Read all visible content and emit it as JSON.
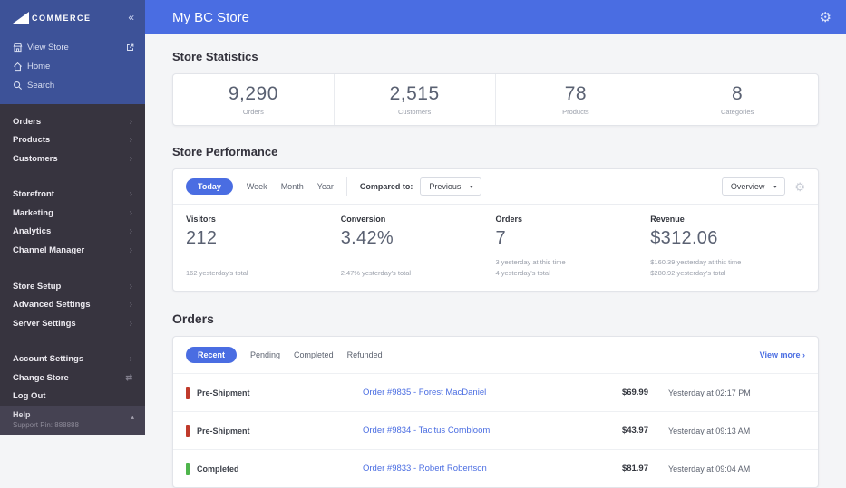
{
  "colors": {
    "header_blue": "#4a6de2",
    "sidebar_top_blue": "#3d5298",
    "sidebar_dark": "#37343f",
    "link_blue": "#4a6de2",
    "status_pre_shipment": "#c03a2b",
    "status_completed": "#4fb54c"
  },
  "icons": {
    "collapse": "«",
    "chevron_right": "›",
    "caret_down": "▾",
    "caret_up": "▴",
    "gear": "⚙",
    "swap": "⇄",
    "view_more_arrow": "›"
  },
  "sidebar": {
    "logo_text": "COMMERCE",
    "top_items": [
      {
        "label": "View Store"
      },
      {
        "label": "Home"
      },
      {
        "label": "Search"
      }
    ],
    "groups": [
      {
        "items": [
          {
            "label": "Orders"
          },
          {
            "label": "Products"
          },
          {
            "label": "Customers"
          }
        ]
      },
      {
        "items": [
          {
            "label": "Storefront"
          },
          {
            "label": "Marketing"
          },
          {
            "label": "Analytics"
          },
          {
            "label": "Channel Manager"
          }
        ]
      },
      {
        "items": [
          {
            "label": "Store Setup"
          },
          {
            "label": "Advanced Settings"
          },
          {
            "label": "Server Settings"
          }
        ]
      },
      {
        "items": [
          {
            "label": "Account Settings"
          },
          {
            "label": "Change Store"
          },
          {
            "label": "Log Out"
          }
        ]
      }
    ],
    "help": {
      "title": "Help",
      "subtitle": "Support Pin: 888888"
    }
  },
  "header": {
    "title": "My BC Store"
  },
  "store_statistics": {
    "heading": "Store Statistics",
    "stats": [
      {
        "value": "9,290",
        "label": "Orders"
      },
      {
        "value": "2,515",
        "label": "Customers"
      },
      {
        "value": "78",
        "label": "Products"
      },
      {
        "value": "8",
        "label": "Categories"
      }
    ]
  },
  "store_performance": {
    "heading": "Store Performance",
    "range_tabs": [
      "Today",
      "Week",
      "Month",
      "Year"
    ],
    "active_range": "Today",
    "compared_to_label": "Compared to:",
    "compared_to_value": "Previous",
    "view_value": "Overview",
    "metrics": [
      {
        "label": "Visitors",
        "value": "212",
        "sub1": "",
        "sub2": "162 yesterday's total"
      },
      {
        "label": "Conversion",
        "value": "3.42%",
        "sub1": "",
        "sub2": "2.47% yesterday's total"
      },
      {
        "label": "Orders",
        "value": "7",
        "sub1": "3 yesterday at this time",
        "sub2": "4 yesterday's total"
      },
      {
        "label": "Revenue",
        "value": "$312.06",
        "sub1": "$160.39 yesterday at this time",
        "sub2": "$280.92 yesterday's total"
      }
    ]
  },
  "orders_section": {
    "heading": "Orders",
    "active_tab": "Recent",
    "tabs": [
      "Recent",
      "Pending",
      "Completed",
      "Refunded"
    ],
    "view_more": "View more",
    "rows": [
      {
        "status": "Pre-Shipment",
        "order": "Order #9835 - Forest MacDaniel",
        "amount": "$69.99",
        "time": "Yesterday at 02:17 PM"
      },
      {
        "status": "Pre-Shipment",
        "order": "Order #9834 - Tacitus Cornbloom",
        "amount": "$43.97",
        "time": "Yesterday at 09:13 AM"
      },
      {
        "status": "Completed",
        "order": "Order #9833 - Robert Robertson",
        "amount": "$81.97",
        "time": "Yesterday at 09:04 AM"
      }
    ]
  }
}
